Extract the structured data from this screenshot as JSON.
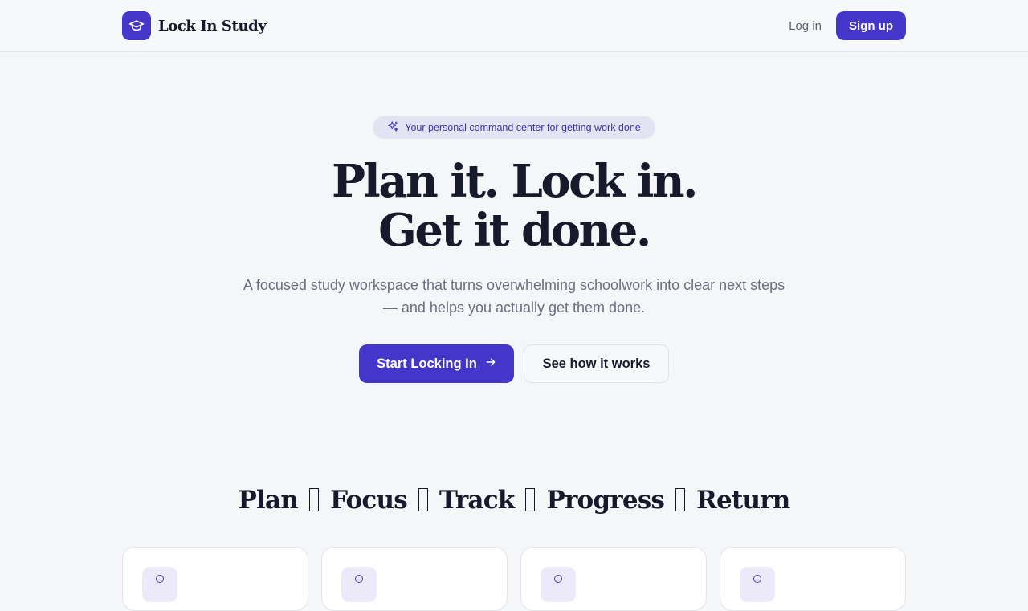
{
  "brand": {
    "name": "Lock In Study",
    "logo_icon": "graduation-cap-icon",
    "accent": "#4436c8"
  },
  "nav": {
    "login": "Log in",
    "signup": "Sign up"
  },
  "hero": {
    "badge_icon": "sparkles-icon",
    "badge": "Your personal command center for getting work done",
    "headline_line1": "Plan it. Lock in.",
    "headline_line2": "Get it done.",
    "subtitle": "A focused study workspace that turns overwhelming schoolwork into clear next steps — and helps you actually get them done.",
    "primary_cta": "Start Locking In",
    "primary_cta_icon": "arrow-right-icon",
    "secondary_cta": "See how it works"
  },
  "flow": {
    "steps": [
      "Plan",
      "Focus",
      "Track",
      "Progress",
      "Return"
    ]
  }
}
